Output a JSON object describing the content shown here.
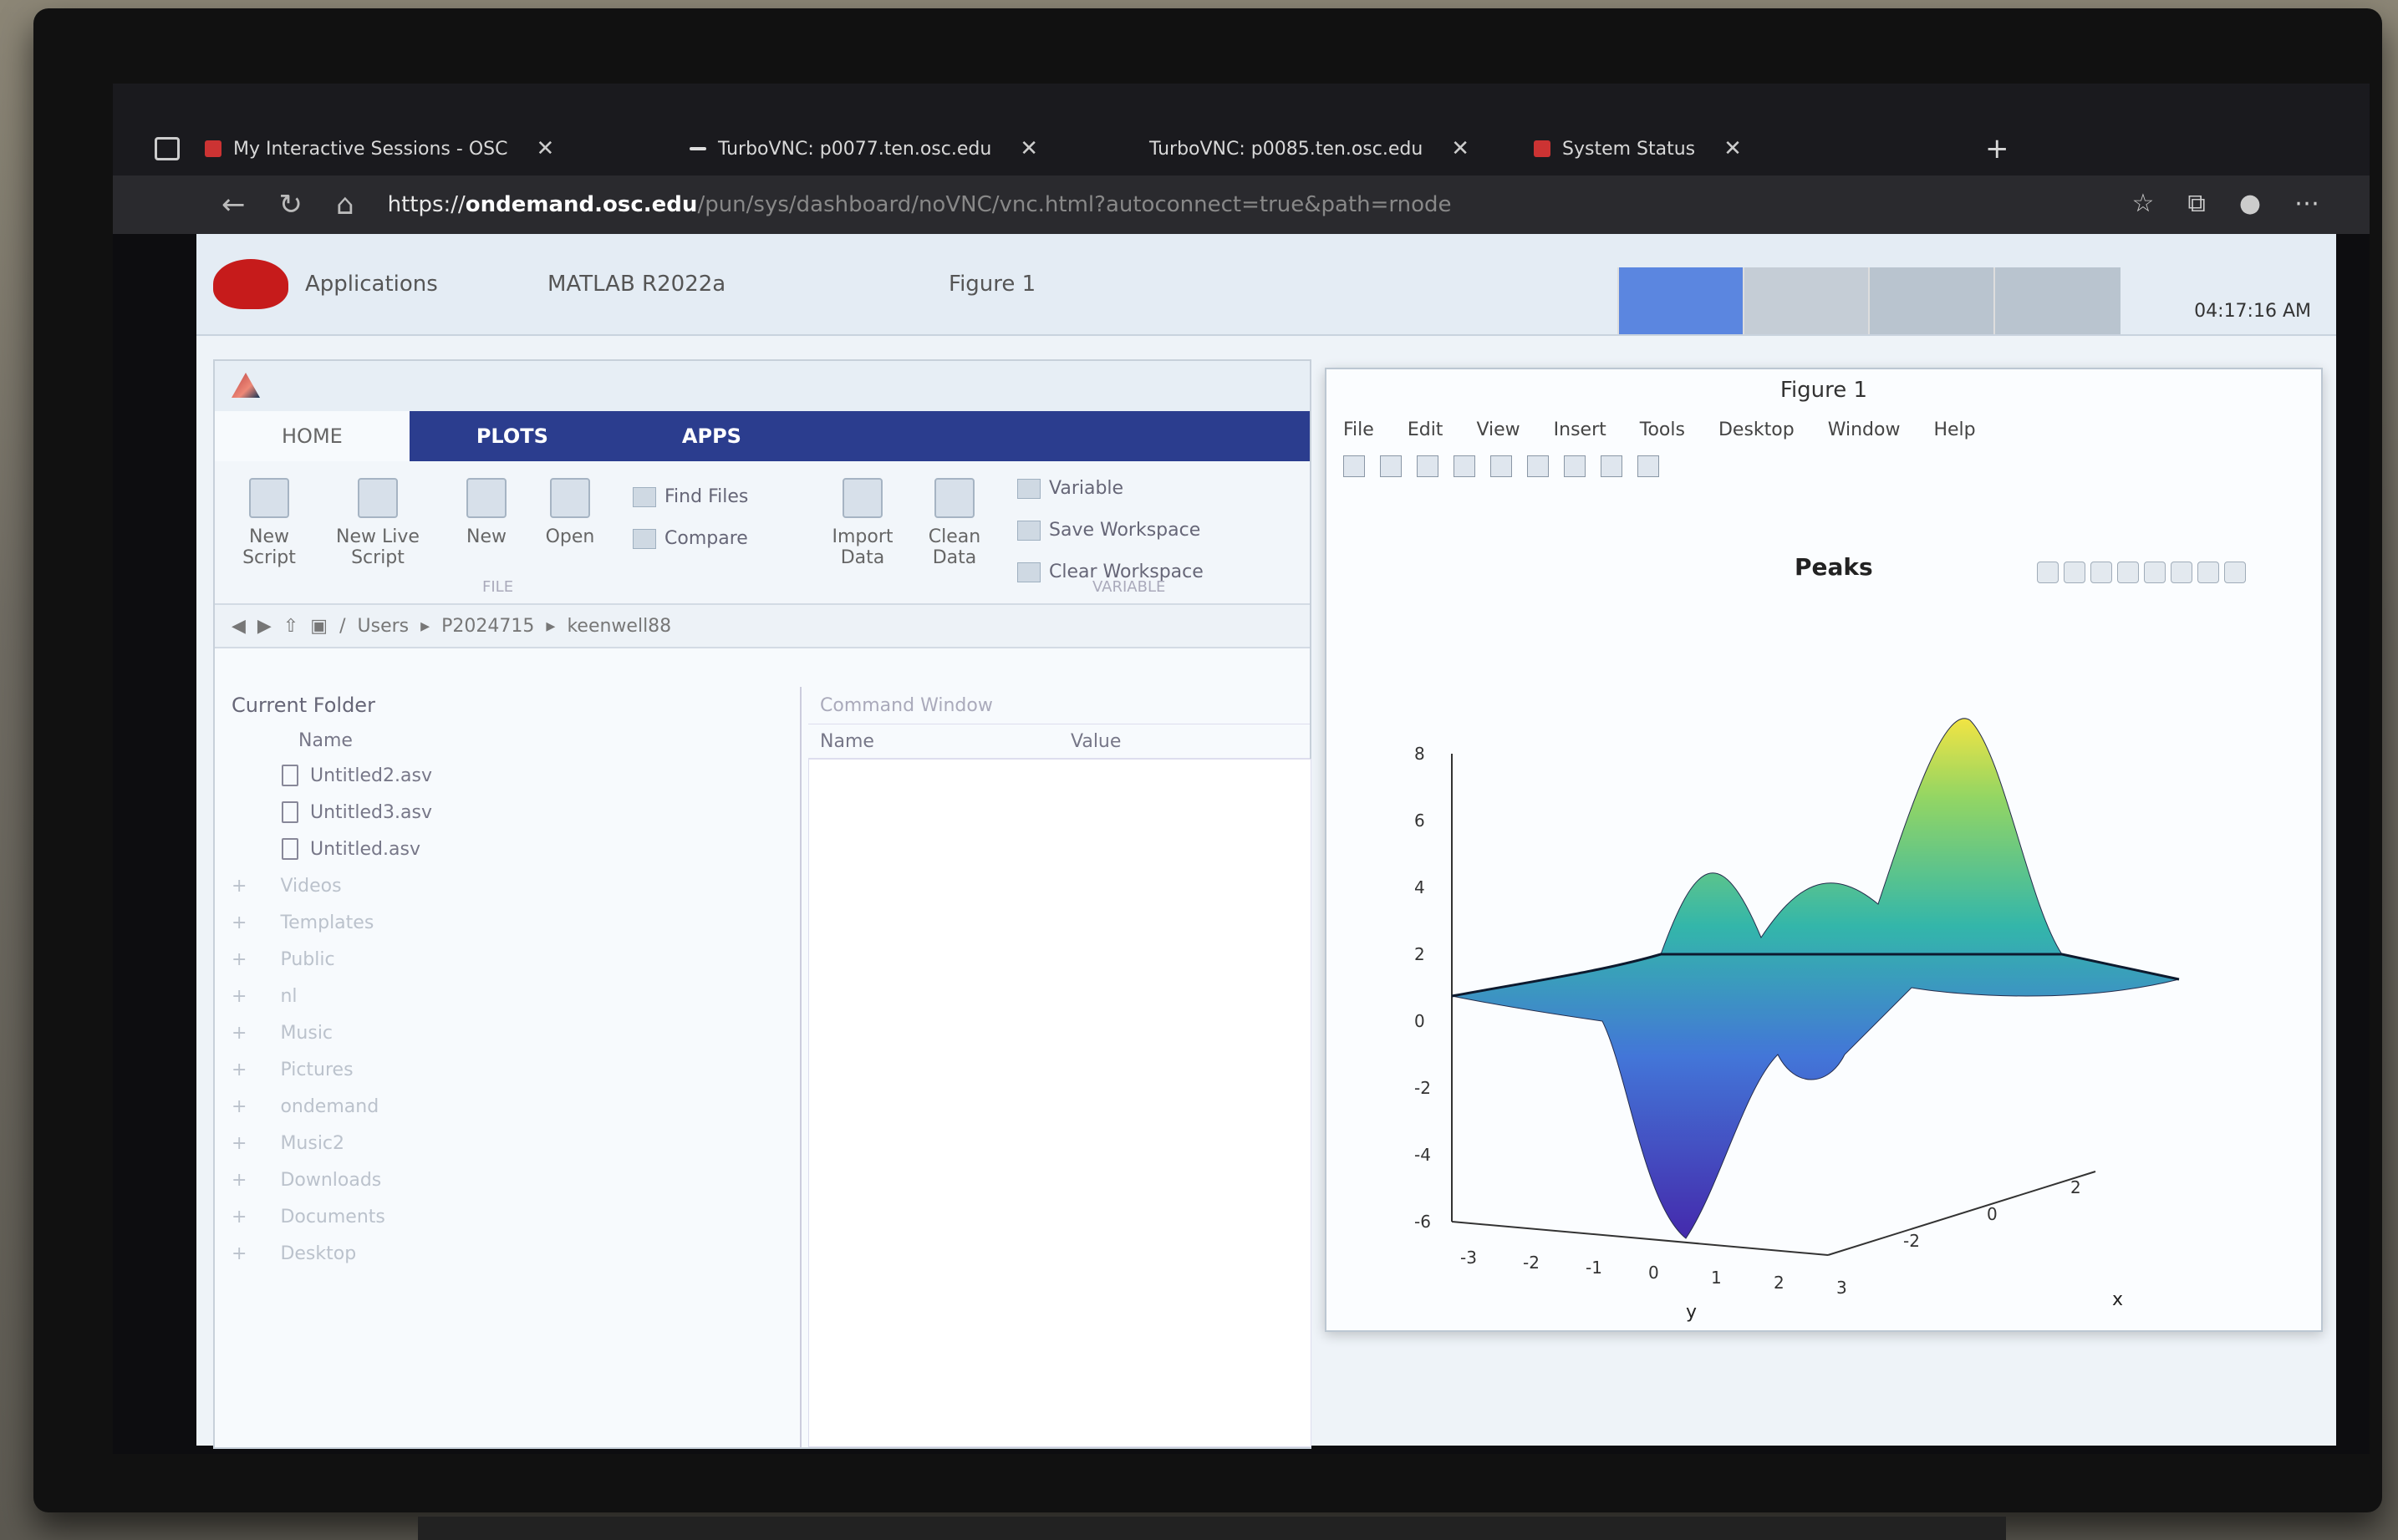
{
  "browser": {
    "tabs": [
      {
        "label": "My Interactive Sessions - OSC"
      },
      {
        "label": "TurboVNC: p0077.ten.osc.edu"
      },
      {
        "label": "TurboVNC: p0085.ten.osc.edu"
      },
      {
        "label": "System Status"
      }
    ],
    "url_prefix": "https://",
    "url_host": "ondemand.osc.edu",
    "url_rest": "/pun/sys/dashboard/noVNC/vnc.html?autoconnect=true&path=rnode"
  },
  "desktop": {
    "applications_label": "Applications",
    "matlab_task": "MATLAB R2022a",
    "figure_task": "Figure 1",
    "clock": "04:17:16 AM"
  },
  "matlab": {
    "ribbon_tabs": [
      "HOME",
      "PLOTS",
      "APPS"
    ],
    "buttons": [
      {
        "label": "New Script"
      },
      {
        "label": "New Live Script"
      },
      {
        "label": "New"
      },
      {
        "label": "Open"
      },
      {
        "label": "Import Data"
      },
      {
        "label": "Clean Data"
      }
    ],
    "file_buttons": [
      "Find Files",
      "Compare"
    ],
    "variable_buttons": [
      "Variable",
      "Save Workspace",
      "Clear Workspace"
    ],
    "section_file": "FILE",
    "section_variable": "VARIABLE",
    "path": [
      "Users",
      "P2024715",
      "keenwell88"
    ],
    "current_folder_label": "Current Folder",
    "name_col": "Name",
    "files": [
      "Untitled2.asv",
      "Untitled3.asv",
      "Untitled.asv"
    ],
    "folders": [
      "Videos",
      "Templates",
      "Public",
      "nl",
      "Music",
      "Pictures",
      "ondemand",
      "Music2",
      "Downloads",
      "Documents",
      "Desktop"
    ],
    "command_window_label": "Command Window",
    "ws_columns": [
      "Name",
      "Value"
    ]
  },
  "figure": {
    "title": "Figure 1",
    "menu": [
      "File",
      "Edit",
      "View",
      "Insert",
      "Tools",
      "Desktop",
      "Window",
      "Help"
    ],
    "plot_title": "Peaks",
    "z_ticks": [
      "8",
      "6",
      "4",
      "2",
      "0",
      "-2",
      "-4",
      "-6"
    ],
    "y_ticks": [
      "-3",
      "-2",
      "-1",
      "0",
      "1",
      "2",
      "3"
    ],
    "x_ticks": [
      "-2",
      "0",
      "2"
    ],
    "y_label": "y",
    "x_label": "x"
  }
}
